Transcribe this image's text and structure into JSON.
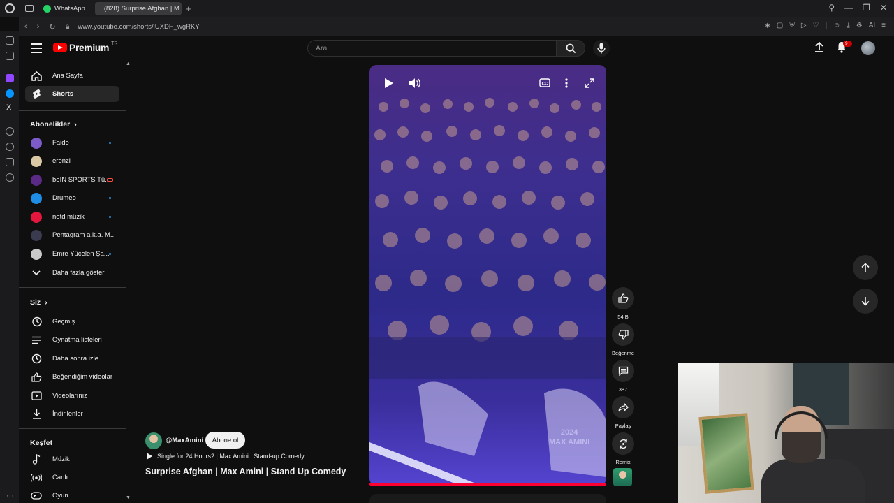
{
  "browser": {
    "tabs": [
      {
        "label": "WhatsApp",
        "active": false
      },
      {
        "label": "(828) Surprise Afghan | M",
        "active": true
      }
    ],
    "url": "www.youtube.com/shorts/iUXDH_wgRKY",
    "ext_text": "AI"
  },
  "header": {
    "logo_text": "Premium",
    "logo_country": "TR",
    "search_placeholder": "Ara",
    "notification_count": "9+"
  },
  "guide": {
    "main": [
      {
        "label": "Ana Sayfa",
        "icon": "home-icon"
      },
      {
        "label": "Shorts",
        "icon": "shorts-icon",
        "active": true
      }
    ],
    "subscriptions_title": "Abonelikler",
    "subscriptions": [
      {
        "label": "Faide",
        "color": "#7b5cc9",
        "indicator": "dot"
      },
      {
        "label": "erenzi",
        "color": "#d9c8a4",
        "indicator": "none"
      },
      {
        "label": "beIN SPORTS Tü...",
        "color": "#5b2a86",
        "indicator": "live"
      },
      {
        "label": "Drumeo",
        "color": "#1f8ce5",
        "indicator": "dot"
      },
      {
        "label": "netd müzik",
        "color": "#e3173e",
        "indicator": "dot"
      },
      {
        "label": "Pentagram a.k.a. M...",
        "color": "#3b3b4f",
        "indicator": "none"
      },
      {
        "label": "Emre Yücelen Şa...",
        "color": "#c9c9c9",
        "indicator": "dot"
      }
    ],
    "show_more": "Daha fazla göster",
    "you_title": "Siz",
    "you": [
      {
        "label": "Geçmiş",
        "icon": "history-icon"
      },
      {
        "label": "Oynatma listeleri",
        "icon": "playlists-icon"
      },
      {
        "label": "Daha sonra izle",
        "icon": "watch-later-icon"
      },
      {
        "label": "Beğendiğim videolar",
        "icon": "liked-videos-icon"
      },
      {
        "label": "Videolarınız",
        "icon": "your-videos-icon"
      },
      {
        "label": "İndirilenler",
        "icon": "downloads-icon"
      }
    ],
    "explore_title": "Keşfet",
    "explore": [
      {
        "label": "Müzik",
        "icon": "music-icon"
      },
      {
        "label": "Canlı",
        "icon": "live-icon"
      },
      {
        "label": "Oyun",
        "icon": "gaming-icon"
      }
    ]
  },
  "short": {
    "channel": "@MaxAmini",
    "subscribe_label": "Abone ol",
    "related": "Single for 24 Hours? | Max Amini | Stand-up Comedy",
    "title": "Surprise Afghan | Max Amini | Stand Up Comedy",
    "watermark_year": "2024",
    "watermark_name": "MAX AMINI",
    "progress": 1.0
  },
  "actions": {
    "likes": "54 B",
    "dislike_label": "Beğenme",
    "comments": "387",
    "share_label": "Paylaş",
    "remix_label": "Remix"
  }
}
